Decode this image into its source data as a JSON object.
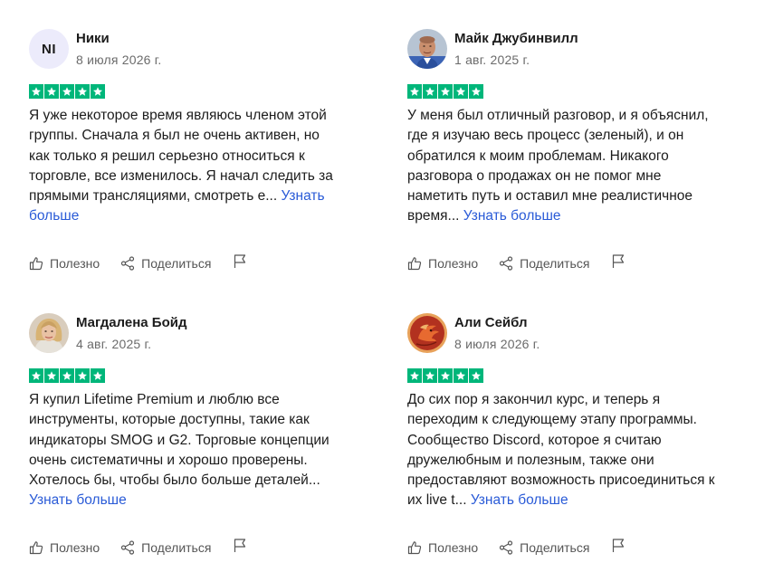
{
  "reviews": [
    {
      "name": "Ники",
      "initials": "NI",
      "date": "8 июля 2026 г.",
      "rating": 5,
      "text": "Я уже некоторое время являюсь членом этой группы. Сначала я был не очень активен, но как только я решил серьезно относиться к торговле, все изменилось. Я начал следить за прямыми трансляциями, смотреть е...",
      "more": "Узнать больше",
      "helpful": "Полезно",
      "share": "Поделиться"
    },
    {
      "name": "Майк Джубинвилл",
      "initials": "",
      "date": "1 авг. 2025 г.",
      "rating": 5,
      "text": "У меня был отличный разговор, и я объяснил, где я изучаю весь процесс (зеленый), и он обратился к моим проблемам. Никакого разговора о продажах он не помог мне наметить путь и оставил мне реалистичное время...",
      "more": "Узнать больше",
      "helpful": "Полезно",
      "share": "Поделиться"
    },
    {
      "name": "Магдалена Бойд",
      "initials": "",
      "date": "4 авг. 2025 г.",
      "rating": 5,
      "text": "Я купил Lifetime Premium и люблю все инструменты, которые доступны, такие как индикаторы SMOG и G2. Торговые концепции очень систематичны и хорошо проверены. Хотелось бы, чтобы было больше деталей...",
      "more": "Узнать больше",
      "helpful": "Полезно",
      "share": "Поделиться"
    },
    {
      "name": "Али Сейбл",
      "initials": "",
      "date": "8 июля 2026 г.",
      "rating": 5,
      "text": "До сих пор я закончил курс, и теперь я переходим к следующему этапу программы. Сообщество Discord, которое я считаю дружелюбным и полезным, также они предоставляют возможность присоединиться к их live t...",
      "more": "Узнать больше",
      "helpful": "Полезно",
      "share": "Поделиться"
    }
  ],
  "colors": {
    "star_green": "#00b67a",
    "link_blue": "#2a5bd7",
    "initials_bg": "#ecebfb",
    "muted_text": "#6b6b6b"
  },
  "icons": {
    "helpful": "thumbs-up-icon",
    "share": "share-icon",
    "report": "flag-icon",
    "star": "star-icon"
  }
}
